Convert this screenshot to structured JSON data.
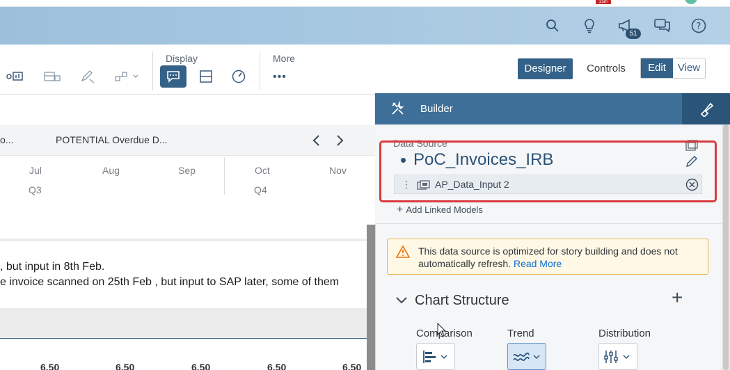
{
  "shell": {
    "notification_count": "51",
    "browser_badge": "25m"
  },
  "toolbar": {
    "display_label": "Display",
    "more_label": "More",
    "more_dots": "•••"
  },
  "mode": {
    "designer_label": "Designer",
    "controls_label": "Controls",
    "edit_label": "Edit",
    "view_label": "View"
  },
  "story": {
    "header_left": "o...",
    "header_col": "POTENTIAL Overdue D...",
    "months": [
      "Jul",
      "Aug",
      "Sep",
      "Oct",
      "Nov"
    ],
    "quarters": [
      "Q3",
      "Q4"
    ],
    "comment_line1": ", but input in 8th Feb.",
    "comment_line2": "e invoice scanned on 25th Feb , but input to SAP later, some of them",
    "numbers": [
      "6.50",
      "6.50",
      "6.50",
      "6.50",
      "6.50"
    ]
  },
  "builder": {
    "title": "Builder",
    "data_source_label": "Data Source",
    "data_source_name": "PoC_Invoices_IRB",
    "linked_model_name": "AP_Data_Input 2",
    "add_linked_models": "Add Linked Models",
    "warning_text": "This data source is optimized for story building and does not automatically refresh.",
    "warning_link": "Read More",
    "chart_structure_title": "Chart Structure",
    "types": [
      {
        "label": "Comparison",
        "selected": false
      },
      {
        "label": "Trend",
        "selected": true
      },
      {
        "label": "Distribution",
        "selected": false
      }
    ]
  },
  "colors": {
    "accent": "#346187",
    "panel_header": "#3d6f98",
    "highlight": "#d93a3e",
    "warning_border": "#e9b44c"
  }
}
